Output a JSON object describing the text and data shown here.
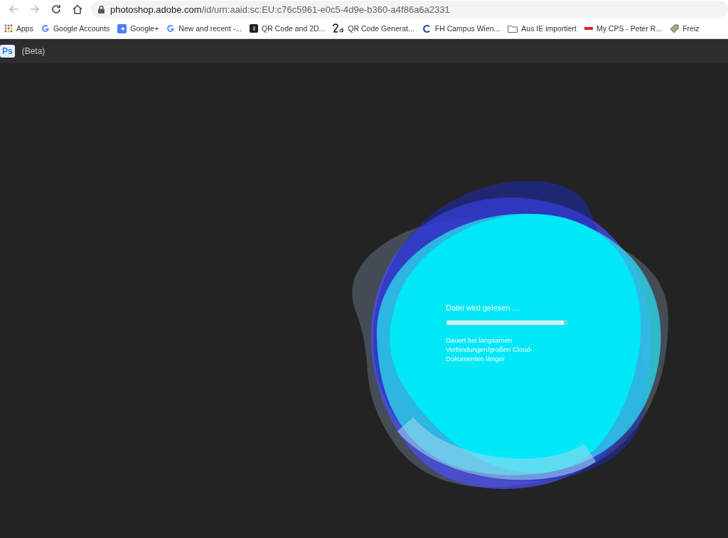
{
  "browser": {
    "url_host": "photoshop.adobe.com",
    "url_path": "/id/urn:aaid:sc:EU:c76c5961-e0c5-4d9e-b360-a4f86a6a2331"
  },
  "bookmarks": [
    {
      "kind": "apps",
      "label": "Apps"
    },
    {
      "kind": "google",
      "label": "Google Accounts"
    },
    {
      "kind": "gplus",
      "label": "Google+"
    },
    {
      "kind": "google",
      "label": "New and recent -..."
    },
    {
      "kind": "qr",
      "label": "QR Code and 2D..."
    },
    {
      "kind": "twod",
      "label": "QR Code Generat..."
    },
    {
      "kind": "campus",
      "label": "FH Campus Wien..."
    },
    {
      "kind": "folder",
      "label": "Aus IE importiert"
    },
    {
      "kind": "canon",
      "label": "My CPS - Peter R..."
    },
    {
      "kind": "gem",
      "label": "Freiz"
    }
  ],
  "app": {
    "logo": "Ps",
    "title": "(Beta)"
  },
  "loader": {
    "status": "Datei wird gelesen ...",
    "level": 0.97,
    "hint": "Dauert bei langsamen Verbindungen/großen Cloud-Dokumenten länger"
  }
}
